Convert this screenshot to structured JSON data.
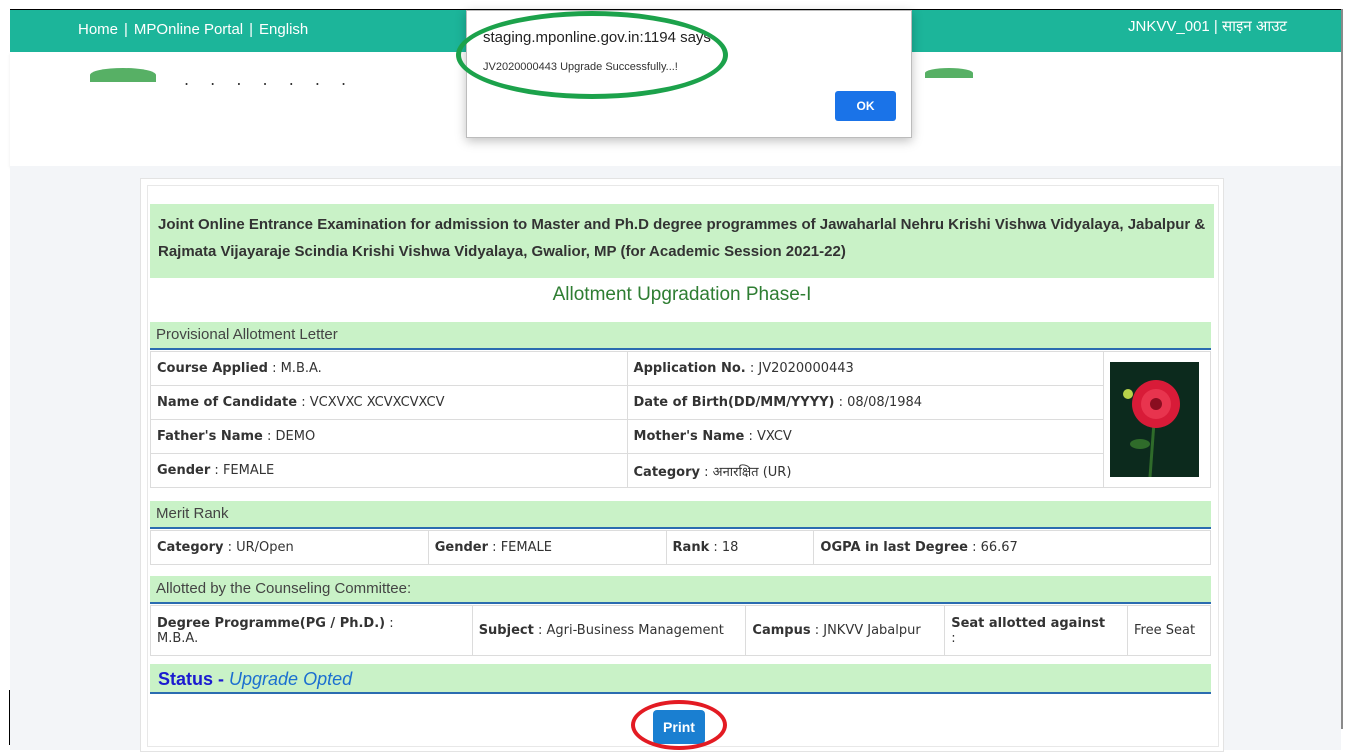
{
  "topbar": {
    "home": "Home",
    "portal": "MPOnline Portal",
    "language": "English",
    "user": "JNKVV_001 | साइन आउट"
  },
  "header": {
    "logo_text": ". . . . . . ."
  },
  "banner": "Joint Online Entrance Examination for admission to Master and Ph.D degree programmes of Jawaharlal Nehru Krishi Vishwa Vidyalaya, Jabalpur & Rajmata Vijayaraje Scindia Krishi Vishwa Vidyalaya, Gwalior, MP (for Academic Session 2021-22)",
  "page_title": "Allotment Upgradation Phase-I",
  "provisional": {
    "heading": "Provisional Allotment Letter",
    "course_label": "Course Applied",
    "course": "M.B.A.",
    "appno_label": "Application No.",
    "appno": "JV2020000443",
    "name_label": "Name of Candidate",
    "name": "VCXVXC XCVXCVXCV",
    "dob_label": "Date of Birth(DD/MM/YYYY)",
    "dob": "08/08/1984",
    "father_label": "Father's Name",
    "father": "DEMO",
    "mother_label": "Mother's Name",
    "mother": "VXCV",
    "gender_label": "Gender",
    "gender": "FEMALE",
    "category_label": "Category",
    "category": "अनारक्षित (UR)"
  },
  "merit": {
    "heading": "Merit Rank",
    "category_label": "Category",
    "category": "UR/Open",
    "gender_label": "Gender",
    "gender": "FEMALE",
    "rank_label": "Rank",
    "rank": "18",
    "ogpa_label": "OGPA in last Degree",
    "ogpa": "66.67"
  },
  "allotted": {
    "heading": "Allotted by the Counseling Committee:",
    "degree_label": "Degree Programme(PG / Ph.D.)",
    "degree": "M.B.A.",
    "subject_label": "Subject",
    "subject": "Agri-Business Management",
    "campus_label": "Campus",
    "campus": "JNKVV Jabalpur",
    "seat_label": "Seat allotted against",
    "seat": "Free Seat"
  },
  "status": {
    "label": "Status - ",
    "value": "Upgrade Opted"
  },
  "print_label": "Print",
  "dialog": {
    "host": "staging.mponline.gov.in:1194 says",
    "message": "JV2020000443 Upgrade Successfully...!",
    "ok": "OK"
  },
  "colors": {
    "topbar": "#1cb59a",
    "section": "#c9f2c7",
    "button": "#1a7fd1",
    "green_ring": "#1ca24b",
    "red_ring": "#e31b23"
  }
}
